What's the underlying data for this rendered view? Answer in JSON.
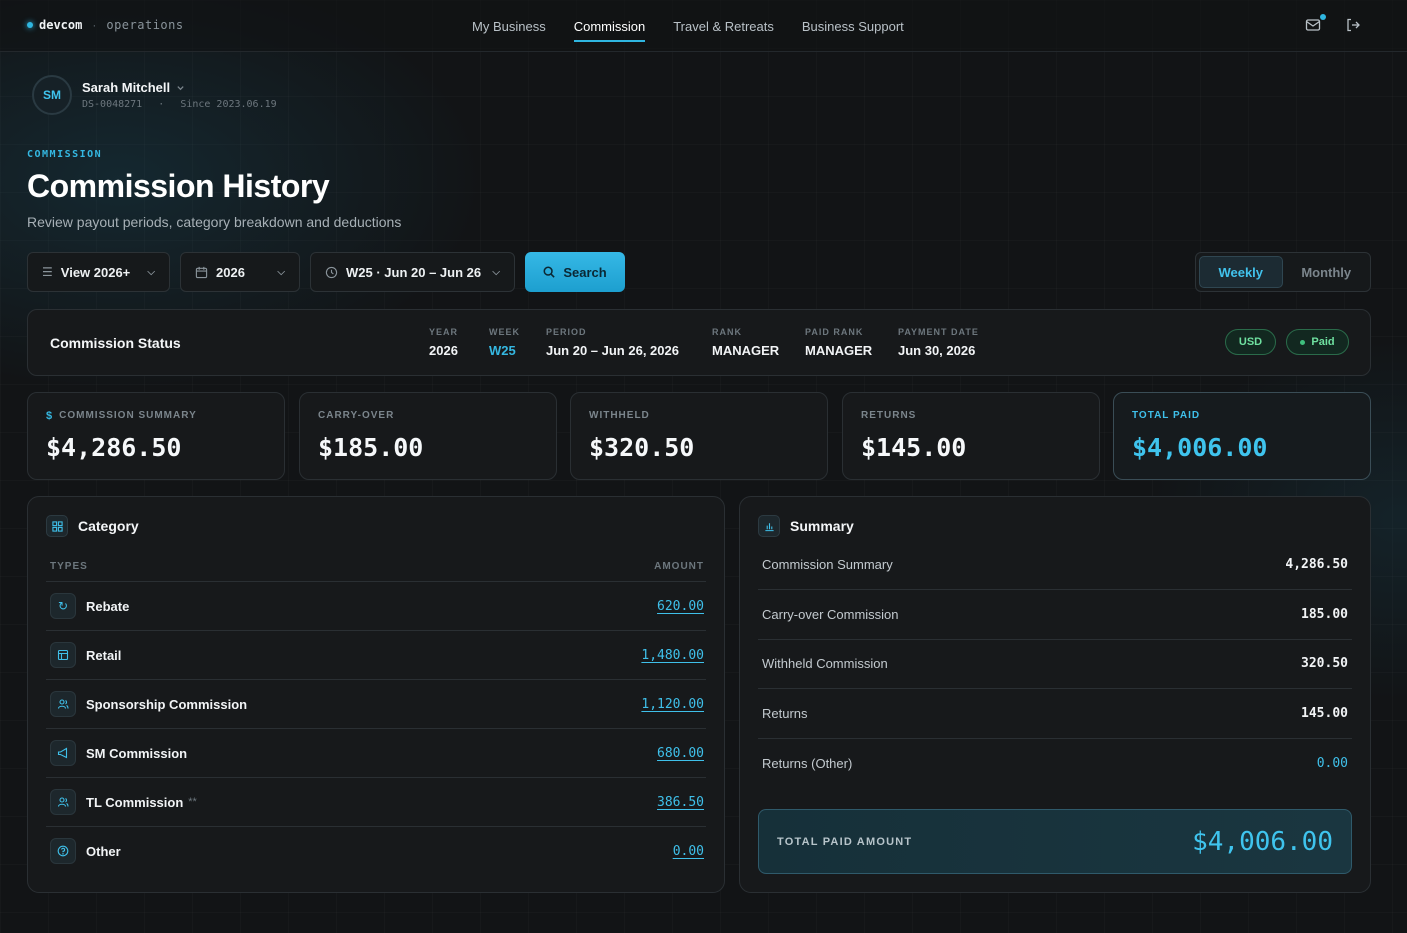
{
  "brand": {
    "name": "devcom",
    "separator": "·",
    "sub": "operations"
  },
  "nav": {
    "links": [
      "My Business",
      "Commission",
      "Travel & Retreats",
      "Business Support"
    ],
    "active": "Commission"
  },
  "user": {
    "initials": "SM",
    "name": "Sarah Mitchell",
    "id": "DS-0048271",
    "separator": "·",
    "since": "Since 2023.06.19"
  },
  "page": {
    "eyebrow": "COMMISSION",
    "title": "Commission History",
    "subtitle": "Review payout periods, category breakdown and deductions"
  },
  "filters": {
    "view": "View 2026+",
    "year": "2026",
    "week": "W25 · Jun 20 – Jun 26",
    "search": "Search",
    "toggle": [
      "Weekly",
      "Monthly"
    ],
    "toggle_active": "Weekly"
  },
  "status": {
    "title": "Commission Status",
    "year_label": "YEAR",
    "year": "2026",
    "week_label": "WEEK",
    "week": "W25",
    "period_label": "PERIOD",
    "period": "Jun 20 – Jun 26, 2026",
    "rank_label": "RANK",
    "rank": "MANAGER",
    "paid_rank_label": "PAID RANK",
    "paid_rank": "MANAGER",
    "payment_label": "PAYMENT DATE",
    "payment": "Jun 30, 2026",
    "currency": "USD",
    "state": "Paid"
  },
  "cards": [
    {
      "label": "COMMISSION SUMMARY",
      "value": "$4,286.50",
      "prefix": "$"
    },
    {
      "label": "CARRY-OVER",
      "value": "$185.00"
    },
    {
      "label": "WITHHELD",
      "value": "$320.50"
    },
    {
      "label": "RETURNS",
      "value": "$145.00"
    },
    {
      "label": "TOTAL PAID",
      "value": "$4,006.00"
    }
  ],
  "category": {
    "title": "Category",
    "col_types": "TYPES",
    "col_amount": "AMOUNT",
    "rows": [
      {
        "name": "Rebate",
        "amount": "620.00",
        "icon": "refresh-icon",
        "note": ""
      },
      {
        "name": "Retail",
        "amount": "1,480.00",
        "icon": "store-icon",
        "note": ""
      },
      {
        "name": "Sponsorship Commission",
        "amount": "1,120.00",
        "icon": "users-icon",
        "note": ""
      },
      {
        "name": "SM Commission",
        "amount": "680.00",
        "icon": "megaphone-icon",
        "note": ""
      },
      {
        "name": "TL Commission",
        "amount": "386.50",
        "icon": "team-icon",
        "note": "**"
      },
      {
        "name": "Other",
        "amount": "0.00",
        "icon": "help-icon",
        "note": ""
      }
    ]
  },
  "summary": {
    "title": "Summary",
    "rows": [
      {
        "label": "Commission Summary",
        "value": "4,286.50"
      },
      {
        "label": "Carry-over Commission",
        "value": "185.00"
      },
      {
        "label": "Withheld Commission",
        "value": "320.50"
      },
      {
        "label": "Returns",
        "value": "145.00"
      },
      {
        "label": "Returns (Other)",
        "value": "0.00"
      }
    ],
    "total_label": "TOTAL PAID AMOUNT",
    "total_value": "$4,006.00"
  },
  "colors": {
    "accent": "#2fb6e0",
    "success": "#6fe0a0",
    "background": "#121416"
  }
}
